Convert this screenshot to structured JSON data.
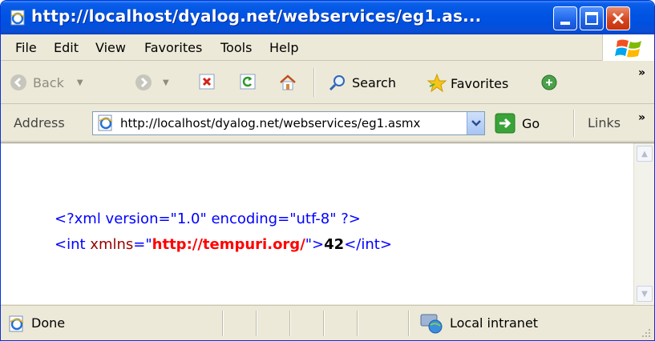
{
  "window": {
    "title": "http://localhost/dyalog.net/webservices/eg1.as...",
    "colors": {
      "titlebar": "#0054e3",
      "chrome": "#ece9d8",
      "close": "#d6451f"
    }
  },
  "menu": [
    {
      "label": "File"
    },
    {
      "label": "Edit"
    },
    {
      "label": "View"
    },
    {
      "label": "Favorites"
    },
    {
      "label": "Tools"
    },
    {
      "label": "Help"
    }
  ],
  "toolbar": {
    "back_label": "Back",
    "search_label": "Search",
    "favorites_label": "Favorites",
    "overflow": "»"
  },
  "address": {
    "label": "Address",
    "url": "http://localhost/dyalog.net/webservices/eg1.asmx",
    "go_label": "Go",
    "links_label": "Links",
    "overflow": "»"
  },
  "content": {
    "xml_decl": "<?xml version=\"1.0\" encoding=\"utf-8\" ?>",
    "open_tag": "<int",
    "attr_name": "xmlns",
    "attr_eq": "=\"",
    "attr_value": "http://tempuri.org/",
    "attr_close": "\">",
    "text_value": "42",
    "close_tag": "</int>"
  },
  "status": {
    "left_text": "Done",
    "zone_text": "Local intranet"
  }
}
